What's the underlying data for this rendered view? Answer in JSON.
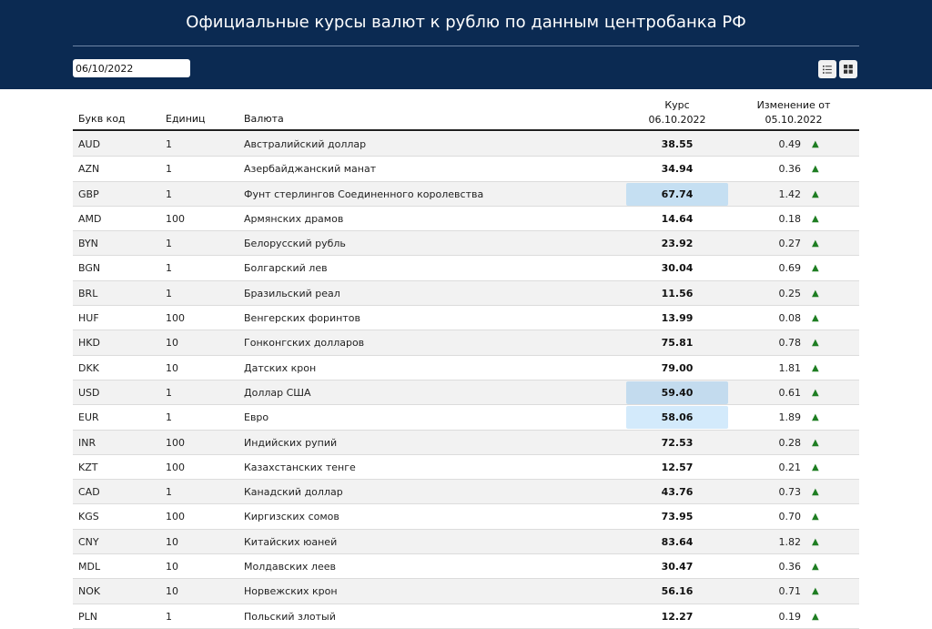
{
  "header": {
    "title": "Официальные курсы валют к рублю по данным центробанка РФ",
    "date_value": "06/10/2022",
    "list_view_icon": "list-icon",
    "grid_view_icon": "grid-icon"
  },
  "table": {
    "columns": {
      "code": "Букв код",
      "units": "Единиц",
      "name": "Валюта",
      "rate_line1": "Курс",
      "rate_line2": "06.10.2022",
      "change_line1": "Изменение от",
      "change_line2": "05.10.2022"
    },
    "rows": [
      {
        "code": "AUD",
        "units": "1",
        "name": "Австралийский доллар",
        "rate": "38.55",
        "change": "0.49",
        "arrow": "▲",
        "highlight": ""
      },
      {
        "code": "AZN",
        "units": "1",
        "name": "Азербайджанский манат",
        "rate": "34.94",
        "change": "0.36",
        "arrow": "▲",
        "highlight": ""
      },
      {
        "code": "GBP",
        "units": "1",
        "name": "Фунт стерлингов Соединенного королевства",
        "rate": "67.74",
        "change": "1.42",
        "arrow": "▲",
        "highlight": "#c5dff2"
      },
      {
        "code": "AMD",
        "units": "100",
        "name": "Армянских драмов",
        "rate": "14.64",
        "change": "0.18",
        "arrow": "▲",
        "highlight": ""
      },
      {
        "code": "BYN",
        "units": "1",
        "name": "Белорусский рубль",
        "rate": "23.92",
        "change": "0.27",
        "arrow": "▲",
        "highlight": ""
      },
      {
        "code": "BGN",
        "units": "1",
        "name": "Болгарский лев",
        "rate": "30.04",
        "change": "0.69",
        "arrow": "▲",
        "highlight": ""
      },
      {
        "code": "BRL",
        "units": "1",
        "name": "Бразильский реал",
        "rate": "11.56",
        "change": "0.25",
        "arrow": "▲",
        "highlight": ""
      },
      {
        "code": "HUF",
        "units": "100",
        "name": "Венгерских форинтов",
        "rate": "13.99",
        "change": "0.08",
        "arrow": "▲",
        "highlight": ""
      },
      {
        "code": "HKD",
        "units": "10",
        "name": "Гонконгских долларов",
        "rate": "75.81",
        "change": "0.78",
        "arrow": "▲",
        "highlight": ""
      },
      {
        "code": "DKK",
        "units": "10",
        "name": "Датских крон",
        "rate": "79.00",
        "change": "1.81",
        "arrow": "▲",
        "highlight": ""
      },
      {
        "code": "USD",
        "units": "1",
        "name": "Доллар США",
        "rate": "59.40",
        "change": "0.61",
        "arrow": "▲",
        "highlight": "#c3dbee"
      },
      {
        "code": "EUR",
        "units": "1",
        "name": "Евро",
        "rate": "58.06",
        "change": "1.89",
        "arrow": "▲",
        "highlight": "#d3eafb"
      },
      {
        "code": "INR",
        "units": "100",
        "name": "Индийских рупий",
        "rate": "72.53",
        "change": "0.28",
        "arrow": "▲",
        "highlight": ""
      },
      {
        "code": "KZT",
        "units": "100",
        "name": "Казахстанских тенге",
        "rate": "12.57",
        "change": "0.21",
        "arrow": "▲",
        "highlight": ""
      },
      {
        "code": "CAD",
        "units": "1",
        "name": "Канадский доллар",
        "rate": "43.76",
        "change": "0.73",
        "arrow": "▲",
        "highlight": ""
      },
      {
        "code": "KGS",
        "units": "100",
        "name": "Киргизских сомов",
        "rate": "73.95",
        "change": "0.70",
        "arrow": "▲",
        "highlight": ""
      },
      {
        "code": "CNY",
        "units": "10",
        "name": "Китайских юаней",
        "rate": "83.64",
        "change": "1.82",
        "arrow": "▲",
        "highlight": ""
      },
      {
        "code": "MDL",
        "units": "10",
        "name": "Молдавских леев",
        "rate": "30.47",
        "change": "0.36",
        "arrow": "▲",
        "highlight": ""
      },
      {
        "code": "NOK",
        "units": "10",
        "name": "Норвежских крон",
        "rate": "56.16",
        "change": "0.71",
        "arrow": "▲",
        "highlight": ""
      },
      {
        "code": "PLN",
        "units": "1",
        "name": "Польский злотый",
        "rate": "12.27",
        "change": "0.19",
        "arrow": "▲",
        "highlight": ""
      }
    ]
  },
  "colors": {
    "header_bg": "#0b2a52",
    "arrow_up": "#1e7d22",
    "row_alt": "#f2f2f2"
  }
}
